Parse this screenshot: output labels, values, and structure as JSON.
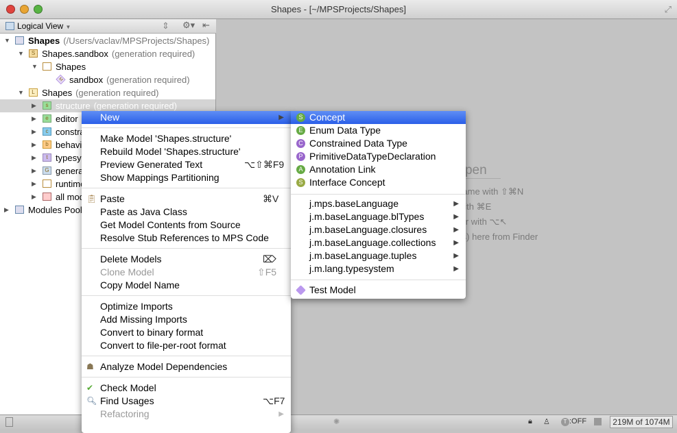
{
  "window": {
    "title": "Shapes - [~/MPSProjects/Shapes]"
  },
  "toolbar": {
    "view_selector": "Logical View"
  },
  "tree": [
    {
      "label": "Shapes",
      "note": "(/Users/vaclav/MPSProjects/Shapes)"
    },
    {
      "label": "Shapes.sandbox",
      "note": "(generation required)"
    },
    {
      "label": "Shapes",
      "note": ""
    },
    {
      "label": "sandbox",
      "note": "(generation required)"
    },
    {
      "label": "Shapes",
      "note": "(generation required)"
    },
    {
      "label": "structure",
      "note": "(generation required)"
    },
    {
      "label": "editor",
      "note": ""
    },
    {
      "label": "constraints",
      "note": ""
    },
    {
      "label": "behavior",
      "note": ""
    },
    {
      "label": "typesystem",
      "note": ""
    },
    {
      "label": "generator",
      "note": ""
    },
    {
      "label": "runtime",
      "note": ""
    },
    {
      "label": "all models",
      "note": ""
    },
    {
      "label": "Modules Pool",
      "note": ""
    }
  ],
  "editor_hints": {
    "title": "No files are open",
    "lines": [
      "Search for file by name with ⇧⌘N",
      "Open recent files with ⌘E",
      "Open navigation bar with ⌥↖",
      "Drag and drop file(s) here from Finder"
    ]
  },
  "context_menu": {
    "new": "New",
    "groups": [
      [
        {
          "label": "Make Model 'Shapes.structure'"
        },
        {
          "label": "Rebuild Model 'Shapes.structure'"
        },
        {
          "label": "Preview Generated Text",
          "shortcut": "⌥⇧⌘F9"
        },
        {
          "label": "Show Mappings Partitioning"
        }
      ],
      [
        {
          "label": "Paste",
          "shortcut": "⌘V"
        },
        {
          "label": "Paste as Java Class"
        },
        {
          "label": "Get Model Contents from Source"
        },
        {
          "label": "Resolve Stub References to MPS Code"
        }
      ],
      [
        {
          "label": "Delete Models",
          "shortcut": "⌦"
        },
        {
          "label": "Clone Model",
          "shortcut": "⇧F5",
          "disabled": true
        },
        {
          "label": "Copy Model Name"
        }
      ],
      [
        {
          "label": "Optimize Imports"
        },
        {
          "label": "Add Missing Imports"
        },
        {
          "label": "Convert to binary format"
        },
        {
          "label": "Convert to file-per-root format"
        }
      ],
      [
        {
          "label": "Analyze Model Dependencies"
        }
      ],
      [
        {
          "label": "Check Model"
        },
        {
          "label": "Find Usages",
          "shortcut": "⌥F7"
        },
        {
          "label": "Refactoring",
          "disabled": true
        }
      ]
    ]
  },
  "submenu": {
    "concepts": [
      {
        "label": "Concept",
        "badge": "S"
      },
      {
        "label": "Enum Data Type",
        "badge": "E"
      },
      {
        "label": "Constrained Data Type",
        "badge": "C"
      },
      {
        "label": "PrimitiveDataTypeDeclaration",
        "badge": "P"
      },
      {
        "label": "Annotation Link",
        "badge": "A"
      },
      {
        "label": "Interface Concept",
        "badge": "S"
      }
    ],
    "languages": [
      "j.mps.baseLanguage",
      "j.m.baseLanguage.blTypes",
      "j.m.baseLanguage.closures",
      "j.m.baseLanguage.collections",
      "j.m.baseLanguage.tuples",
      "j.m.lang.typesystem"
    ],
    "test": "Test Model"
  },
  "status": {
    "typing": "T",
    "off": ":OFF",
    "memory": "219M of 1074M"
  }
}
